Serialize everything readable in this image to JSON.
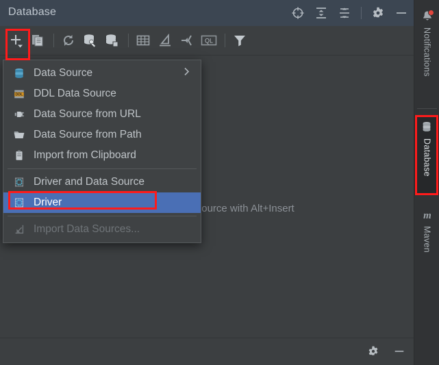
{
  "window": {
    "title": "Database"
  },
  "titlebar": {
    "icons": [
      {
        "name": "scroll-from-source-icon",
        "glyph": "target"
      },
      {
        "name": "expand-all-icon",
        "glyph": "expand"
      },
      {
        "name": "collapse-all-icon",
        "glyph": "collapse"
      },
      {
        "name": "settings-gear-icon",
        "glyph": "gear"
      },
      {
        "name": "minimize-icon",
        "glyph": "minus"
      }
    ]
  },
  "toolbar": {
    "items": [
      {
        "name": "add-new-button",
        "tooltip": "New",
        "glyph": "plus-dropdown"
      },
      {
        "name": "duplicate-button",
        "tooltip": "Duplicate",
        "glyph": "copy"
      },
      {
        "name": "refresh-button",
        "tooltip": "Refresh",
        "glyph": "refresh"
      },
      {
        "name": "database-tools-button",
        "tooltip": "Database Tools",
        "glyph": "db-wrench"
      },
      {
        "name": "data-source-properties-button",
        "tooltip": "Properties",
        "glyph": "db-square"
      },
      {
        "name": "open-table-editor-button",
        "tooltip": "Table Editor",
        "glyph": "table"
      },
      {
        "name": "modify-object-button",
        "tooltip": "Modify",
        "glyph": "pencil"
      },
      {
        "name": "jump-to-console-button",
        "tooltip": "Jump to Console",
        "glyph": "jump-arrow"
      },
      {
        "name": "query-language-button",
        "tooltip": "QL",
        "glyph": "ql-box"
      },
      {
        "name": "filter-button",
        "tooltip": "Filter",
        "glyph": "funnel"
      }
    ]
  },
  "content": {
    "hint_text": "Create a new data source with Alt+Insert"
  },
  "statusbar": {
    "icons": [
      {
        "name": "settings-gear-icon",
        "glyph": "gear"
      },
      {
        "name": "minimize-icon",
        "glyph": "minus"
      }
    ]
  },
  "menu": {
    "items": [
      {
        "label": "Data Source",
        "icon": "database-cylinder-icon",
        "kind": "submenu",
        "state": "normal"
      },
      {
        "label": "DDL Data Source",
        "icon": "ddl-icon",
        "kind": "item",
        "state": "normal"
      },
      {
        "label": "Data Source from URL",
        "icon": "plug-icon",
        "kind": "item",
        "state": "normal"
      },
      {
        "label": "Data Source from Path",
        "icon": "folder-icon",
        "kind": "item",
        "state": "normal"
      },
      {
        "label": "Import from Clipboard",
        "icon": "clipboard-icon",
        "kind": "item",
        "state": "normal"
      },
      {
        "label": "Driver and Data Source",
        "icon": "driver-icon",
        "kind": "item",
        "state": "normal"
      },
      {
        "label": "Driver",
        "icon": "driver-icon",
        "kind": "item",
        "state": "selected"
      },
      {
        "label": "Import Data Sources...",
        "icon": "import-arrow-icon",
        "kind": "item",
        "state": "disabled"
      }
    ]
  },
  "right_strip": {
    "tabs": [
      {
        "label": "Notifications",
        "icon": "bell-icon",
        "active": false,
        "badge": true
      },
      {
        "label": "Database",
        "icon": "database-cylinder-icon",
        "active": true,
        "badge": false
      },
      {
        "label": "Maven",
        "icon": "maven-m-icon",
        "active": false,
        "badge": false
      }
    ]
  },
  "annotations": {
    "boxes": [
      {
        "name": "annotation-add-button",
        "target": "add-new-button"
      },
      {
        "name": "annotation-driver-item",
        "target": "menu-item-driver"
      },
      {
        "name": "annotation-database-tab",
        "target": "right-tab-database"
      }
    ],
    "color": "#ff1b1b"
  },
  "colors": {
    "titlebar_bg": "#3c4652",
    "panel_bg": "#3c3f41",
    "menu_bg": "#3f4244",
    "menu_selection": "#4a6fb5",
    "strip_bg": "#313335",
    "text": "#bfc4c8",
    "text_disabled": "#6f7478",
    "accent_red": "#ff1b1b",
    "db_icon_blue": "#4a9cc4",
    "ddl_icon_orange": "#c88b28"
  }
}
